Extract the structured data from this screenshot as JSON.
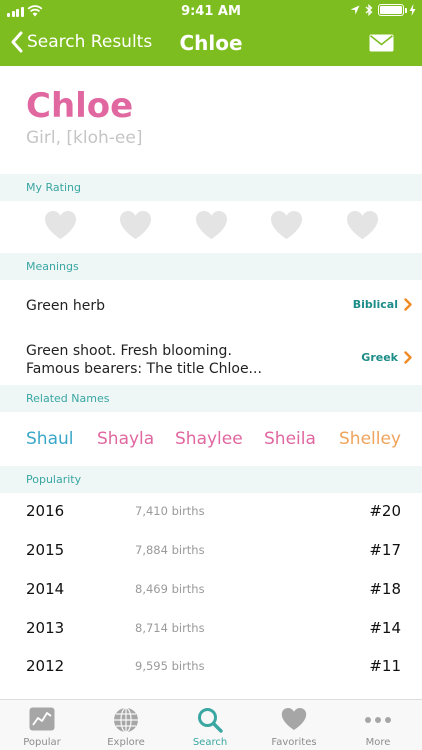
{
  "status": {
    "time": "9:41 AM"
  },
  "nav": {
    "back_label": "Search Results",
    "title": "Chloe"
  },
  "header": {
    "name": "Chloe",
    "subtitle": "Girl, [kloh-ee]"
  },
  "sections": {
    "rating": "My Rating",
    "meanings": "Meanings",
    "related": "Related Names",
    "popularity": "Popularity"
  },
  "rating": {
    "value": 0,
    "max": 5
  },
  "meanings": [
    {
      "text_lines": [
        "Green herb"
      ],
      "origin": "Biblical"
    },
    {
      "text_lines": [
        "Green shoot. Fresh blooming.",
        "Famous bearers: The title Chloe..."
      ],
      "origin": "Greek"
    }
  ],
  "related_names": [
    {
      "name": "Shaul",
      "color": "#3aa7c9"
    },
    {
      "name": "Shayla",
      "color": "#e0679f"
    },
    {
      "name": "Shaylee",
      "color": "#e0679f"
    },
    {
      "name": "Sheila",
      "color": "#e0679f"
    },
    {
      "name": "Shelley",
      "color": "#f0a35a"
    }
  ],
  "popularity": [
    {
      "year": "2016",
      "births": "7,410 births",
      "rank": "#20"
    },
    {
      "year": "2015",
      "births": "7,884 births",
      "rank": "#17"
    },
    {
      "year": "2014",
      "births": "8,469 births",
      "rank": "#18"
    },
    {
      "year": "2013",
      "births": "8,714 births",
      "rank": "#14"
    },
    {
      "year": "2012",
      "births": "9,595 births",
      "rank": "#11"
    }
  ],
  "tabs": [
    {
      "label": "Popular",
      "icon": "chart-icon",
      "active": false
    },
    {
      "label": "Explore",
      "icon": "globe-icon",
      "active": false
    },
    {
      "label": "Search",
      "icon": "search-icon",
      "active": true
    },
    {
      "label": "Favorites",
      "icon": "heart-icon",
      "active": false
    },
    {
      "label": "More",
      "icon": "more-icon",
      "active": false
    }
  ],
  "colors": {
    "brand_green": "#7ebd1f",
    "teal": "#3aa7a2",
    "pink": "#e0679f",
    "heart_empty": "#e4e4e4",
    "origin_arrow": "#f08a24"
  }
}
